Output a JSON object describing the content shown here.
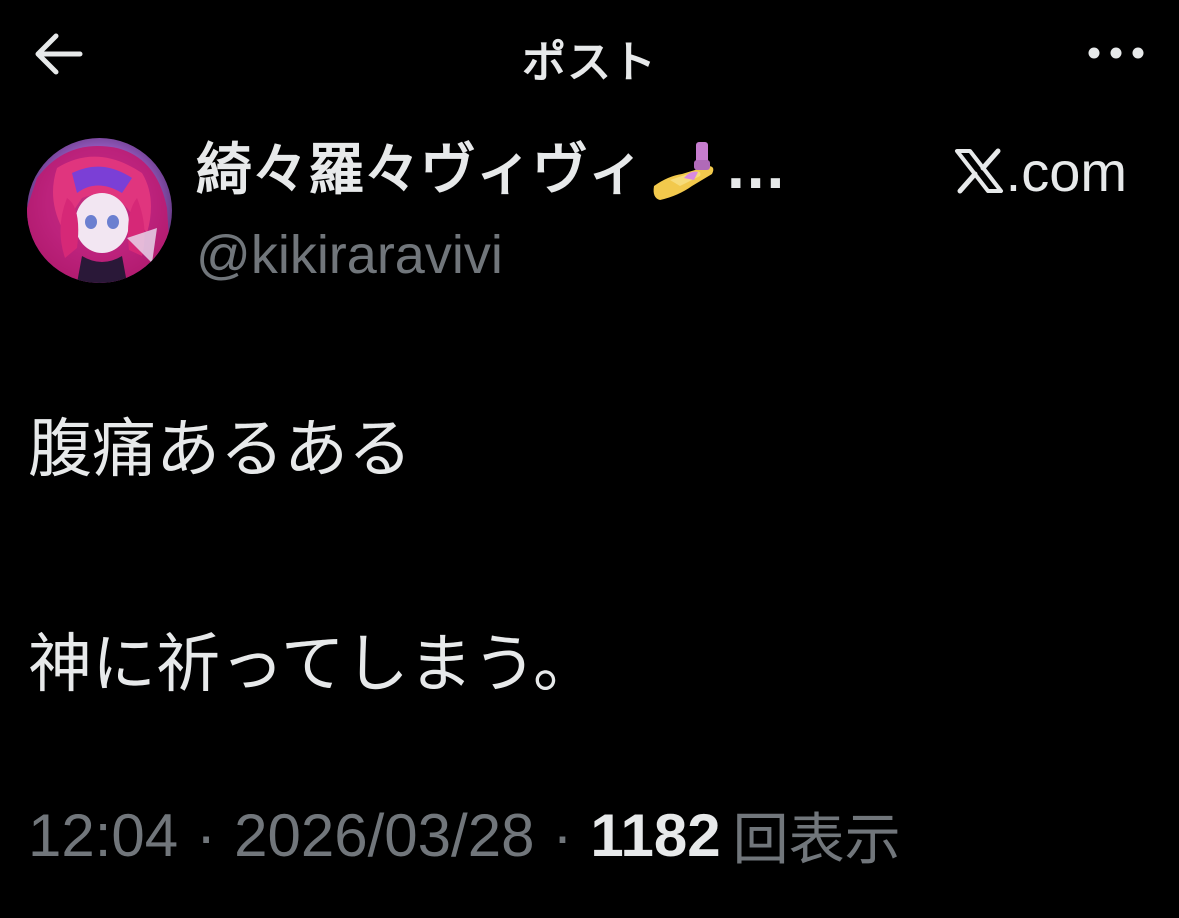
{
  "header": {
    "title": "ポスト",
    "back_icon": "arrow-left-icon",
    "more_icon": "more-horizontal-icon"
  },
  "author": {
    "display_name": "綺々羅々ヴィヴィ",
    "name_emoji": "nail-polish-icon",
    "name_truncation": "...",
    "handle": "@kikiraravivi",
    "avatar": "avatar-image"
  },
  "source": {
    "logo": "x-logo-icon",
    "text": ".com"
  },
  "post": {
    "line1": "腹痛あるある",
    "line2": "神に祈ってしまう。"
  },
  "meta": {
    "time": "12:04",
    "separator": "·",
    "date": "2026/03/28",
    "views_count": "1182",
    "views_label": "回表示"
  },
  "colors": {
    "background": "#000000",
    "primary_text": "#e7e9ea",
    "secondary_text": "#71767b"
  }
}
